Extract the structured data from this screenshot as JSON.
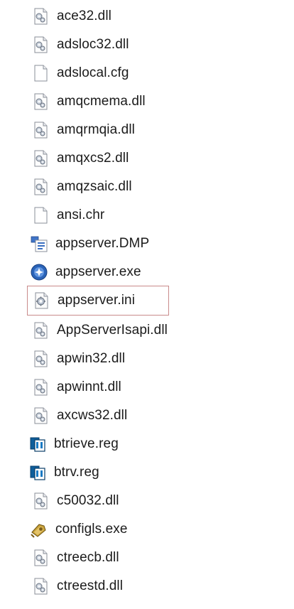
{
  "files": [
    {
      "name": "ace32.dll",
      "icon": "dll-icon"
    },
    {
      "name": "adsloc32.dll",
      "icon": "dll-icon"
    },
    {
      "name": "adslocal.cfg",
      "icon": "blank-file-icon"
    },
    {
      "name": "amqcmema.dll",
      "icon": "dll-icon"
    },
    {
      "name": "amqrmqia.dll",
      "icon": "dll-icon"
    },
    {
      "name": "amqxcs2.dll",
      "icon": "dll-icon"
    },
    {
      "name": "amqzsaic.dll",
      "icon": "dll-icon"
    },
    {
      "name": "ansi.chr",
      "icon": "blank-file-icon"
    },
    {
      "name": "appserver.DMP",
      "icon": "dump-file-icon"
    },
    {
      "name": "appserver.exe",
      "icon": "blue-app-icon"
    },
    {
      "name": "appserver.ini",
      "icon": "ini-settings-icon",
      "selected": true
    },
    {
      "name": "AppServerIsapi.dll",
      "icon": "dll-icon"
    },
    {
      "name": "apwin32.dll",
      "icon": "dll-icon"
    },
    {
      "name": "apwinnt.dll",
      "icon": "dll-icon"
    },
    {
      "name": "axcws32.dll",
      "icon": "dll-icon"
    },
    {
      "name": "btrieve.reg",
      "icon": "registry-file-icon"
    },
    {
      "name": "btrv.reg",
      "icon": "registry-file-icon"
    },
    {
      "name": "c50032.dll",
      "icon": "dll-icon"
    },
    {
      "name": "configls.exe",
      "icon": "tools-app-icon"
    },
    {
      "name": "ctreecb.dll",
      "icon": "dll-icon"
    },
    {
      "name": "ctreestd.dll",
      "icon": "dll-icon"
    }
  ],
  "colors": {
    "selection_border": "#c98a8a",
    "text": "#1b1b1b"
  }
}
